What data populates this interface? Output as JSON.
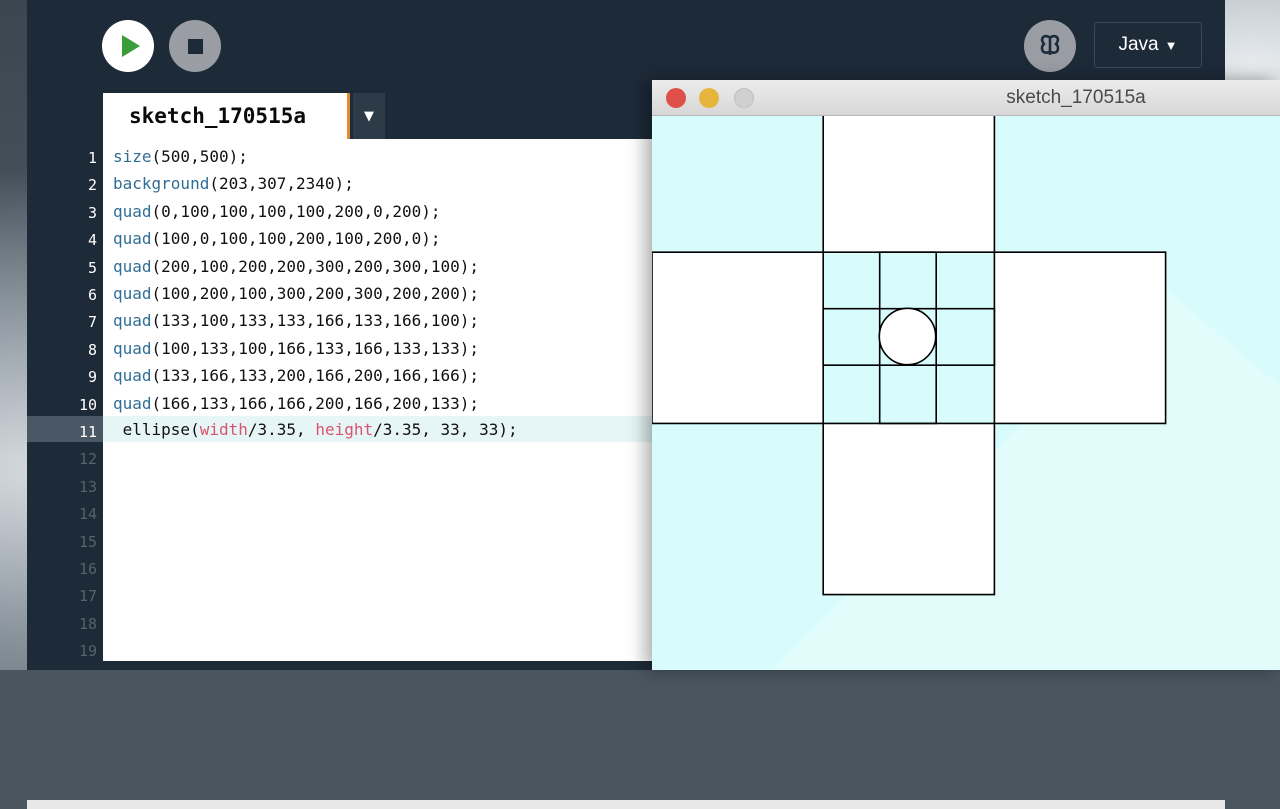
{
  "toolbar": {
    "run_icon": "play-icon",
    "stop_icon": "stop-icon",
    "debug_icon": "butterfly-icon",
    "mode_label": "Java",
    "mode_arrow": "▼"
  },
  "tab": {
    "label": "sketch_170515a",
    "menu_arrow": "▼"
  },
  "editor": {
    "line_numbers": [
      "1",
      "2",
      "3",
      "4",
      "5",
      "6",
      "7",
      "8",
      "9",
      "10",
      "11",
      "12",
      "13",
      "14",
      "15",
      "16",
      "17",
      "18",
      "19"
    ],
    "current_line": 11,
    "lines": [
      {
        "fn": "size",
        "args": "(500,500);"
      },
      {
        "fn": "background",
        "args": "(203,307,2340);"
      },
      {
        "fn": "quad",
        "args": "(0,100,100,100,100,200,0,200);"
      },
      {
        "fn": "quad",
        "args": "(100,0,100,100,200,100,200,0);"
      },
      {
        "fn": "quad",
        "args": "(200,100,200,200,300,200,300,100);"
      },
      {
        "fn": "quad",
        "args": "(100,200,100,300,200,300,200,200);"
      },
      {
        "fn": "quad",
        "args": "(133,100,133,133,166,133,166,100);"
      },
      {
        "fn": "quad",
        "args": "(100,133,100,166,133,166,133,133);"
      },
      {
        "fn": "quad",
        "args": "(133,166,133,200,166,200,166,166);"
      },
      {
        "fn": "quad",
        "args": "(166,133,166,166,200,166,200,133);"
      }
    ],
    "line11": {
      "lead": " ellipse(",
      "kw1": "width",
      "mid": "/3.35, ",
      "kw2": "height",
      "tail": "/3.35, 33, 33);"
    }
  },
  "sketch_window": {
    "title": "sketch_170515a",
    "background_color": "#d8fbfb",
    "shape_fill": "#ffffff",
    "stroke_color": "#000000"
  }
}
